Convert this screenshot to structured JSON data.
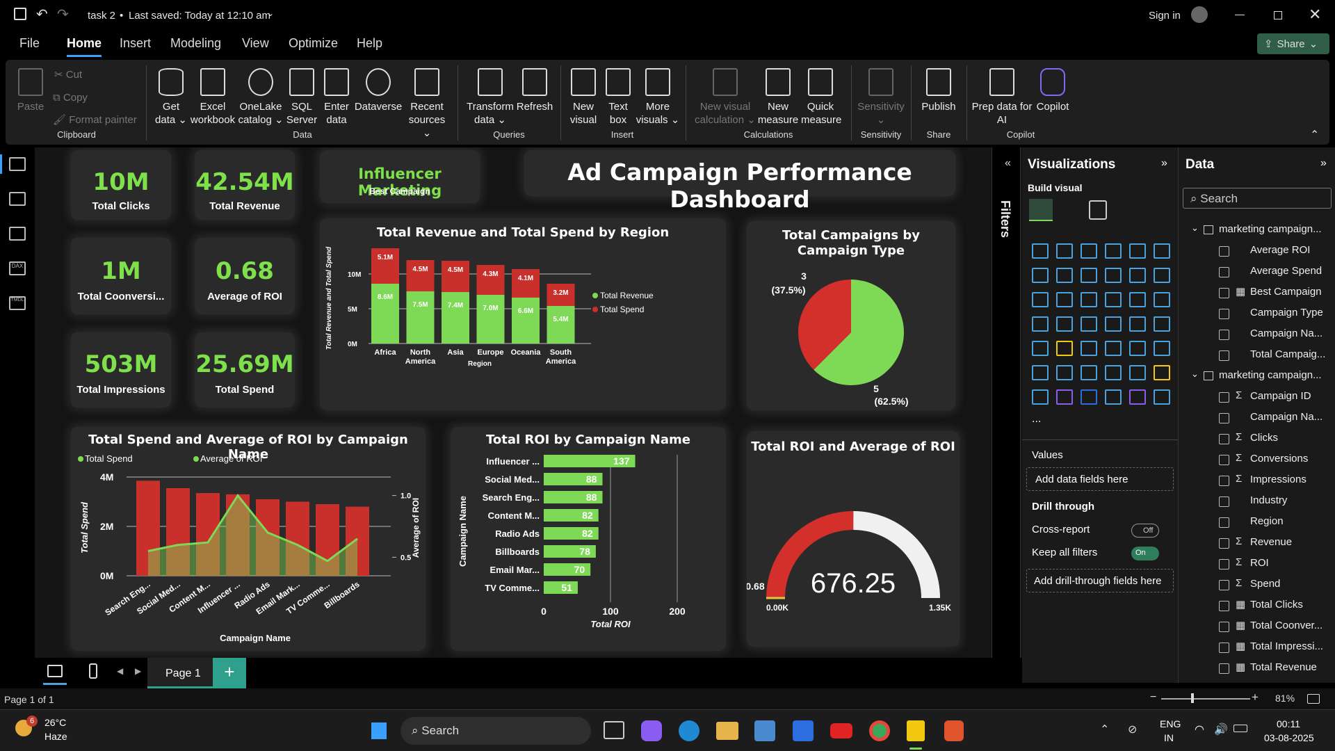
{
  "titlebar": {
    "filename": "task 2",
    "saved": "Last saved: Today at 12:10 am",
    "signin": "Sign in"
  },
  "menu": [
    "File",
    "Home",
    "Insert",
    "Modeling",
    "View",
    "Optimize",
    "Help"
  ],
  "share_label": "Share",
  "ribbon": {
    "clipboard": {
      "paste": "Paste",
      "cut": "Cut",
      "copy": "Copy",
      "format_painter": "Format painter",
      "group": "Clipboard"
    },
    "data": {
      "items": [
        "Get data",
        "Excel workbook",
        "OneLake catalog",
        "SQL Server",
        "Enter data",
        "Dataverse",
        "Recent sources"
      ],
      "group": "Data"
    },
    "queries": {
      "items": [
        "Transform data",
        "Refresh"
      ],
      "group": "Queries"
    },
    "insert": {
      "items": [
        "New visual",
        "Text box",
        "More visuals"
      ],
      "group": "Insert"
    },
    "calculations": {
      "items": [
        "New visual calculation",
        "New measure",
        "Quick measure"
      ],
      "group": "Calculations"
    },
    "sensitivity": {
      "items": [
        "Sensitivity"
      ],
      "group": "Sensitivity"
    },
    "share": {
      "items": [
        "Publish"
      ],
      "group": "Share"
    },
    "copilot": {
      "items": [
        "Prep data for AI",
        "Copilot"
      ],
      "group": "Copilot"
    }
  },
  "kpis": [
    {
      "value": "10M",
      "label": "Total Clicks"
    },
    {
      "value": "42.54M",
      "label": "Total Revenue"
    },
    {
      "value": "1M",
      "label": "Total Coonversi..."
    },
    {
      "value": "0.68",
      "label": "Average of ROI"
    },
    {
      "value": "503M",
      "label": "Total Impressions"
    },
    {
      "value": "25.69M",
      "label": "Total Spend"
    }
  ],
  "best_campaign": {
    "value": "Influencer Marketing",
    "label": "Best Campaign"
  },
  "dashboard_title": "Ad Campaign Performance Dashboard",
  "charts": {
    "region": {
      "title": "Total Revenue and Total Spend by Region",
      "ylabel": "Total Revenue and Total Spend",
      "xlabel": "Region"
    },
    "pie": {
      "title": "Total Campaigns by Campaign Type"
    },
    "spend_roi": {
      "title": "Total Spend and Average of ROI by Campaign Name",
      "xlabel": "Campaign Name",
      "ylabel_left": "Total Spend",
      "ylabel_right": "Average of ROI"
    },
    "roi_bar": {
      "title": "Total ROI by Campaign Name",
      "xlabel": "Total ROI",
      "ylabel": "Campaign Name"
    },
    "gauge": {
      "title": "Total ROI and Average of ROI"
    }
  },
  "chart_data": [
    {
      "type": "bar",
      "title": "Total Revenue and Total Spend by Region",
      "categories": [
        "Africa",
        "North America",
        "Asia",
        "Europe",
        "Oceania",
        "South America"
      ],
      "series": [
        {
          "name": "Total Revenue",
          "values": [
            8.6,
            7.5,
            7.4,
            7.0,
            6.6,
            5.4
          ],
          "labels": [
            "8.6M",
            "7.5M",
            "7.4M",
            "7.0M",
            "6.6M",
            "5.4M"
          ],
          "color": "#7ed957"
        },
        {
          "name": "Total Spend",
          "values": [
            5.1,
            4.5,
            4.5,
            4.3,
            4.1,
            3.2
          ],
          "labels": [
            "5.1M",
            "4.5M",
            "4.5M",
            "4.3M",
            "4.1M",
            "3.2M"
          ],
          "color": "#c9302c"
        }
      ],
      "yticks": [
        "0M",
        "5M",
        "10M"
      ],
      "ylim": [
        0,
        15
      ],
      "stacked": true,
      "legend": "right"
    },
    {
      "type": "pie",
      "title": "Total Campaigns by Campaign Type",
      "slices": [
        {
          "value": 3,
          "pct": "(37.5%)",
          "color": "#d4302b"
        },
        {
          "value": 5,
          "pct": "(62.5%)",
          "color": "#7ed957"
        }
      ]
    },
    {
      "type": "bar",
      "title": "Total Spend and Average of ROI by Campaign Name",
      "categories": [
        "Search Eng...",
        "Social Med...",
        "Content M...",
        "Influencer ...",
        "Radio Ads",
        "Email Mark...",
        "TV Comme...",
        "Billboards"
      ],
      "series": [
        {
          "name": "Total Spend",
          "values": [
            3.85,
            3.55,
            3.35,
            3.3,
            3.1,
            3.0,
            2.9,
            2.8
          ],
          "color": "#c9302c"
        },
        {
          "name": "Average of ROI",
          "values": [
            0.55,
            0.6,
            0.62,
            1.0,
            0.7,
            0.6,
            0.47,
            0.65
          ],
          "color": "#7ed957",
          "type": "area"
        }
      ],
      "yticks_left": [
        "0M",
        "2M",
        "4M"
      ],
      "ylim_left": [
        0,
        4
      ],
      "yticks_right": [
        "0.5",
        "1.0"
      ],
      "ylim_right": [
        0.35,
        1.15
      ],
      "legend": "top-left"
    },
    {
      "type": "bar",
      "orientation": "horizontal",
      "title": "Total ROI by Campaign Name",
      "categories": [
        "Influencer ...",
        "Social Med...",
        "Search Eng...",
        "Content M...",
        "Radio Ads",
        "Billboards",
        "Email Mar...",
        "TV Comme..."
      ],
      "values": [
        137,
        88,
        88,
        82,
        82,
        78,
        70,
        51
      ],
      "xticks": [
        "0",
        "100",
        "200"
      ],
      "xlim": [
        0,
        200
      ]
    },
    {
      "type": "gauge",
      "title": "Total ROI and Average of ROI",
      "value": 676.25,
      "value_label": "676.25",
      "min_label": "0.00K",
      "max_label": "1.35K",
      "target_label": "0.68",
      "max": 1350
    }
  ],
  "filters_label": "Filters",
  "visualizations": {
    "title": "Visualizations",
    "build": "Build visual",
    "values": "Values",
    "add_fields": "Add data fields here",
    "drill": "Drill through",
    "cross": "Cross-report",
    "cross_state": "Off",
    "keep": "Keep all filters",
    "keep_state": "On",
    "add_drill": "Add drill-through fields here",
    "more": "..."
  },
  "data_pane": {
    "title": "Data",
    "search": "Search",
    "table1": "marketing campaign...",
    "table1_fields": [
      {
        "name": "Average ROI",
        "icon": ""
      },
      {
        "name": "Average Spend",
        "icon": ""
      },
      {
        "name": "Best Campaign",
        "icon": "calc"
      },
      {
        "name": "Campaign Type",
        "icon": ""
      },
      {
        "name": "Campaign Na...",
        "icon": ""
      },
      {
        "name": "Total Campaig...",
        "icon": ""
      }
    ],
    "table2": "marketing campaign...",
    "table2_fields": [
      {
        "name": "Campaign ID",
        "icon": "sigma"
      },
      {
        "name": "Campaign Na...",
        "icon": ""
      },
      {
        "name": "Clicks",
        "icon": "sigma"
      },
      {
        "name": "Conversions",
        "icon": "sigma"
      },
      {
        "name": "Impressions",
        "icon": "sigma"
      },
      {
        "name": "Industry",
        "icon": ""
      },
      {
        "name": "Region",
        "icon": ""
      },
      {
        "name": "Revenue",
        "icon": "sigma"
      },
      {
        "name": "ROI",
        "icon": "sigma"
      },
      {
        "name": "Spend",
        "icon": "sigma"
      },
      {
        "name": "Total Clicks",
        "icon": "calc"
      },
      {
        "name": "Total Coonver...",
        "icon": "calc"
      },
      {
        "name": "Total Impressi...",
        "icon": "calc"
      },
      {
        "name": "Total Revenue",
        "icon": "calc"
      }
    ]
  },
  "pages": {
    "current": "Page 1",
    "status": "Page 1 of 1",
    "zoom": "81%"
  },
  "taskbar": {
    "weather_temp": "26°C",
    "weather_desc": "Haze",
    "weather_badge": "6",
    "search": "Search",
    "lang1": "ENG",
    "lang2": "IN",
    "time": "00:11",
    "date": "03-08-2025"
  }
}
